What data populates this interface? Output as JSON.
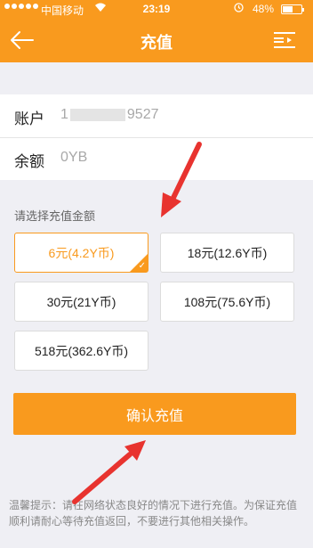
{
  "status_bar": {
    "carrier": "中国移动",
    "time": "23:19",
    "battery": "48%",
    "battery_level": 0.48,
    "icons": [
      "signal-dots-icon",
      "wifi-icon",
      "alarm-icon",
      "battery-icon"
    ]
  },
  "nav": {
    "title": "充值",
    "back_icon": "back-arrow-icon",
    "menu_icon": "menu-list-icon"
  },
  "account": {
    "account_label": "账户",
    "account_prefix": "1",
    "account_suffix": "9527",
    "balance_label": "余额",
    "balance_value": "0YB"
  },
  "recharge": {
    "section_label": "请选择充值金额",
    "options": [
      {
        "label": "6元(4.2Y币)",
        "selected": true
      },
      {
        "label": "18元(12.6Y币)",
        "selected": false
      },
      {
        "label": "30元(21Y币)",
        "selected": false
      },
      {
        "label": "108元(75.6Y币)",
        "selected": false
      },
      {
        "label": "518元(362.6Y币)",
        "selected": false
      }
    ],
    "check_mark": "✓",
    "confirm_label": "确认充值"
  },
  "tip": {
    "text": "温馨提示：请在网络状态良好的情况下进行充值。为保证充值顺利请耐心等待充值返回，不要进行其他相关操作。"
  },
  "colors": {
    "accent": "#f99a1e",
    "background": "#efeff4",
    "annotation_arrow": "#e8332f"
  }
}
